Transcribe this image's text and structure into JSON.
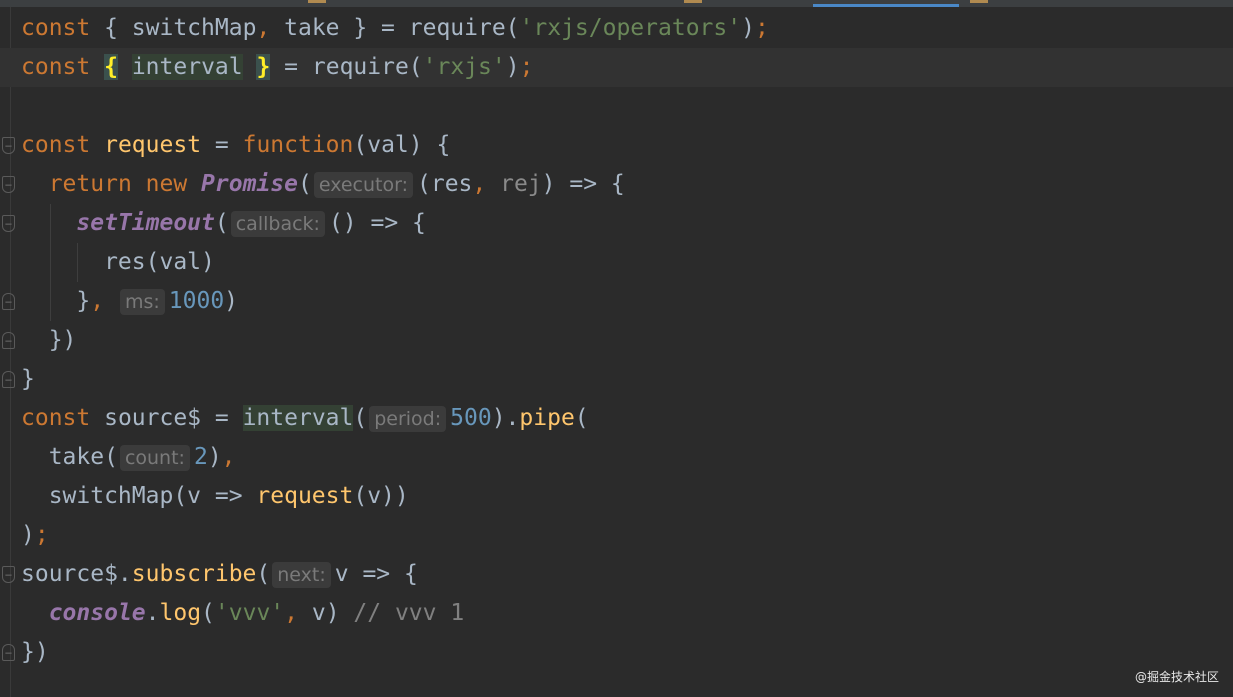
{
  "editor": {
    "colors": {
      "background": "#2b2b2b",
      "keyword": "#cc7832",
      "string": "#6a8759",
      "number": "#6897bb",
      "function": "#ffc66d",
      "italic": "#9876aa",
      "text": "#a9b7c6",
      "comment": "#808080"
    },
    "current_line": 1,
    "lines": [
      {
        "fold": "",
        "tokens": [
          [
            "kw",
            "const"
          ],
          [
            "p",
            " { switchMap"
          ],
          [
            "kw",
            ","
          ],
          [
            "p",
            " take } = require("
          ],
          [
            "str",
            "'rxjs/operators'"
          ],
          [
            "p",
            ")"
          ],
          [
            "kw",
            ";"
          ]
        ]
      },
      {
        "fold": "",
        "tokens": [
          [
            "kw",
            "const"
          ],
          [
            "p",
            " "
          ],
          [
            "brace",
            "{"
          ],
          [
            "p",
            " "
          ],
          [
            "hl",
            "interval"
          ],
          [
            "p",
            " "
          ],
          [
            "brace",
            "}"
          ],
          [
            "p",
            " = require("
          ],
          [
            "str",
            "'rxjs'"
          ],
          [
            "p",
            ")"
          ],
          [
            "kw",
            ";"
          ]
        ]
      },
      {
        "fold": "",
        "tokens": []
      },
      {
        "fold": "start",
        "tokens": [
          [
            "kw",
            "const"
          ],
          [
            "p",
            " "
          ],
          [
            "fn",
            "request"
          ],
          [
            "p",
            " = "
          ],
          [
            "kw",
            "function"
          ],
          [
            "p",
            "(val) {"
          ]
        ]
      },
      {
        "fold": "start",
        "tokens": [
          [
            "p",
            "  "
          ],
          [
            "kw",
            "return new"
          ],
          [
            "p",
            " "
          ],
          [
            "it",
            "Promise"
          ],
          [
            "p",
            "("
          ],
          [
            "hint",
            "executor:"
          ],
          [
            "p",
            "(res"
          ],
          [
            "kw",
            ","
          ],
          [
            "p",
            " "
          ],
          [
            "un",
            "rej"
          ],
          [
            "p",
            ") => {"
          ]
        ]
      },
      {
        "fold": "start",
        "tokens": [
          [
            "p",
            "    "
          ],
          [
            "it",
            "setTimeout"
          ],
          [
            "p",
            "("
          ],
          [
            "hint",
            "callback:"
          ],
          [
            "p",
            "() => {"
          ]
        ]
      },
      {
        "fold": "",
        "tokens": [
          [
            "p",
            "      res(val)"
          ]
        ]
      },
      {
        "fold": "end",
        "tokens": [
          [
            "p",
            "    }"
          ],
          [
            "kw",
            ","
          ],
          [
            "p",
            " "
          ],
          [
            "hint",
            "ms:"
          ],
          [
            "num",
            "1000"
          ],
          [
            "p",
            ")"
          ]
        ]
      },
      {
        "fold": "end",
        "tokens": [
          [
            "p",
            "  })"
          ]
        ]
      },
      {
        "fold": "end",
        "tokens": [
          [
            "p",
            "}"
          ]
        ]
      },
      {
        "fold": "",
        "tokens": [
          [
            "kw",
            "const"
          ],
          [
            "p",
            " source$ = "
          ],
          [
            "hl",
            "interval"
          ],
          [
            "p",
            "("
          ],
          [
            "hint",
            "period:"
          ],
          [
            "num",
            "500"
          ],
          [
            "p",
            ")."
          ],
          [
            "fn",
            "pipe"
          ],
          [
            "p",
            "("
          ]
        ]
      },
      {
        "fold": "",
        "tokens": [
          [
            "p",
            "  take("
          ],
          [
            "hint",
            "count:"
          ],
          [
            "num",
            "2"
          ],
          [
            "p",
            ")"
          ],
          [
            "kw",
            ","
          ]
        ]
      },
      {
        "fold": "",
        "tokens": [
          [
            "p",
            "  switchMap(v => "
          ],
          [
            "fn",
            "request"
          ],
          [
            "p",
            "(v))"
          ]
        ]
      },
      {
        "fold": "",
        "tokens": [
          [
            "p",
            ")"
          ],
          [
            "kw",
            ";"
          ]
        ]
      },
      {
        "fold": "start",
        "tokens": [
          [
            "p",
            "source$."
          ],
          [
            "fn",
            "subscribe"
          ],
          [
            "p",
            "("
          ],
          [
            "hint",
            "next:"
          ],
          [
            "p",
            "v => {"
          ]
        ]
      },
      {
        "fold": "",
        "tokens": [
          [
            "p",
            "  "
          ],
          [
            "it",
            "console"
          ],
          [
            "p",
            "."
          ],
          [
            "fn",
            "log"
          ],
          [
            "p",
            "("
          ],
          [
            "str",
            "'vvv'"
          ],
          [
            "kw",
            ","
          ],
          [
            "p",
            " v) "
          ],
          [
            "cm",
            "// vvv 1"
          ]
        ]
      },
      {
        "fold": "end",
        "tokens": [
          [
            "p",
            "})"
          ]
        ]
      }
    ]
  },
  "watermark": "@掘金技术社区"
}
